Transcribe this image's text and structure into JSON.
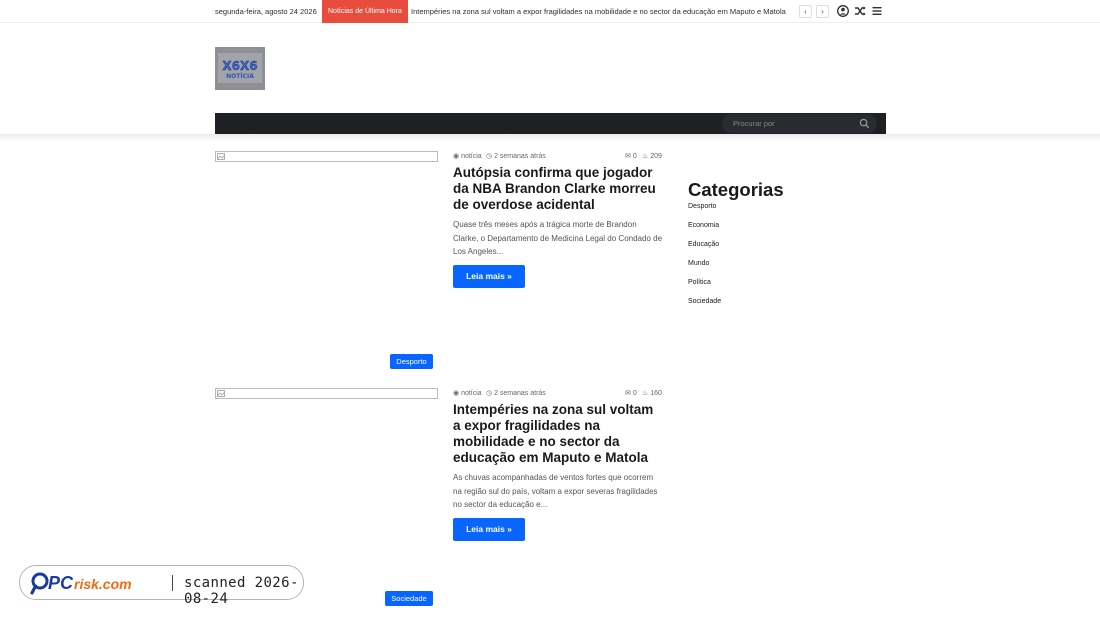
{
  "topbar": {
    "date": "segunda-feira, agosto 24 2026",
    "breaking_label": "Notícias de Última Hora",
    "ticker_text": "Intempéries na zona sul voltam a expor fragilidades na mobilidade e no sector da educação em Maputo e Matola",
    "prev_arrow": "‹",
    "next_arrow": "›",
    "icons": [
      "user-icon",
      "shuffle-icon",
      "menu-icon"
    ]
  },
  "header": {
    "logo_text": "X6X6 NOTÍCIA"
  },
  "search": {
    "placeholder": "Procurar por"
  },
  "posts": [
    {
      "category": "Desporto",
      "author": "notícia",
      "time": "2 semanas atrás",
      "comments": "0",
      "views": "209",
      "title": "Autópsia confirma que jogador da NBA Brandon Clarke morreu de overdose acidental",
      "excerpt": "Quase três meses após a trágica morte de Brandon Clarke, o Departamento de Medicina Legal do Condado de Los Angeles...",
      "more": "Leia mais »"
    },
    {
      "category": "Sociedade",
      "author": "notícia",
      "time": "2 semanas atrás",
      "comments": "0",
      "views": "160",
      "title": "Intempéries na zona sul voltam a expor fragilidades na mobilidade e no sector da educação em Maputo e Matola",
      "excerpt": "As chuvas acompanhadas de ventos fortes que ocorrem na região sul do país, voltam a expor severas fragilidades no sector da educação e...",
      "more": "Leia mais »"
    }
  ],
  "sidebar": {
    "title": "Categorias",
    "items": [
      "Desporto",
      "Economia",
      "Educação",
      "Mundo",
      "Política",
      "Sociedade"
    ]
  },
  "watermark": {
    "brand": "PCrisk.com",
    "text": "scanned 2026-08-24"
  },
  "colors": {
    "accent": "#0866ff",
    "breaking": "#e74c3c",
    "nav": "#1f2024"
  }
}
